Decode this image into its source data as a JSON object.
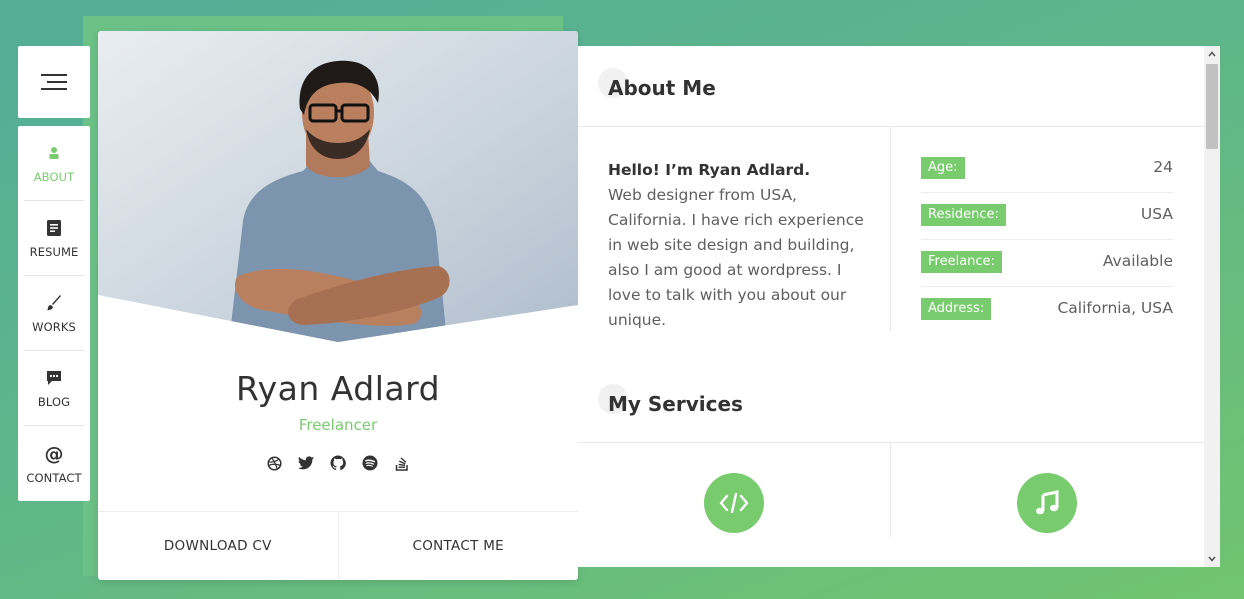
{
  "nav": {
    "items": [
      {
        "label": "ABOUT",
        "icon": "user-icon",
        "active": true
      },
      {
        "label": "RESUME",
        "icon": "document-icon",
        "active": false
      },
      {
        "label": "WORKS",
        "icon": "paintbrush-icon",
        "active": false
      },
      {
        "label": "BLOG",
        "icon": "chat-icon",
        "active": false
      },
      {
        "label": "CONTACT",
        "icon": "at-icon",
        "active": false
      }
    ]
  },
  "profile": {
    "name": "Ryan Adlard",
    "role": "Freelancer",
    "socials": [
      "dribbble-icon",
      "twitter-icon",
      "github-icon",
      "spotify-icon",
      "stackoverflow-icon"
    ],
    "download_label": "DOWNLOAD CV",
    "contact_label": "CONTACT ME"
  },
  "about": {
    "title": "About Me",
    "greeting": "Hello! I’m Ryan Adlard.",
    "text": "Web designer from USA, California. I have rich experience in web site design and building, also I am good at wordpress. I love to talk with you about our unique.",
    "info": [
      {
        "label": "Age:",
        "value": "24"
      },
      {
        "label": "Residence:",
        "value": "USA"
      },
      {
        "label": "Freelance:",
        "value": "Available"
      },
      {
        "label": "Address:",
        "value": "California, USA"
      }
    ]
  },
  "services": {
    "title": "My Services",
    "icons": [
      "code-icon",
      "music-icon"
    ]
  },
  "colors": {
    "accent": "#78cc6d",
    "text": "#323232",
    "muted": "#5f5f5f"
  }
}
